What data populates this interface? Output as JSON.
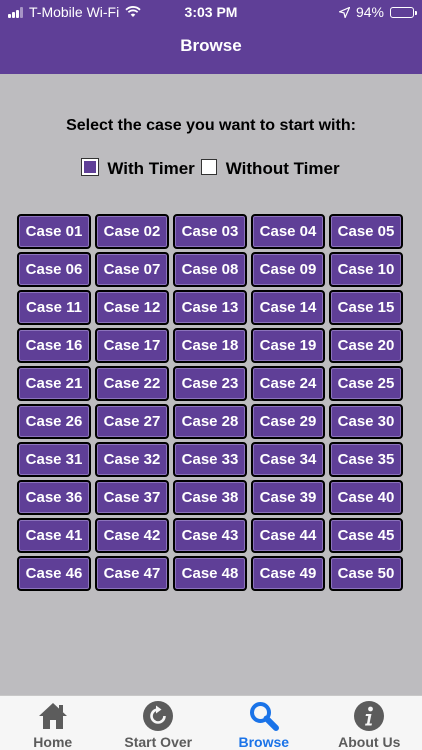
{
  "status_bar": {
    "carrier": "T-Mobile Wi-Fi",
    "time": "3:03 PM",
    "battery": "94%",
    "battery_level": 0.94
  },
  "nav": {
    "title": "Browse"
  },
  "prompt": "Select the case you want to start with:",
  "timer_options": [
    {
      "label": "With Timer",
      "checked": true
    },
    {
      "label": "Without Timer",
      "checked": false
    }
  ],
  "cases": [
    "Case 01",
    "Case 02",
    "Case 03",
    "Case 04",
    "Case 05",
    "Case 06",
    "Case 07",
    "Case 08",
    "Case 09",
    "Case 10",
    "Case 11",
    "Case 12",
    "Case 13",
    "Case 14",
    "Case 15",
    "Case 16",
    "Case 17",
    "Case 18",
    "Case 19",
    "Case 20",
    "Case 21",
    "Case 22",
    "Case 23",
    "Case 24",
    "Case 25",
    "Case 26",
    "Case 27",
    "Case 28",
    "Case 29",
    "Case 30",
    "Case 31",
    "Case 32",
    "Case 33",
    "Case 34",
    "Case 35",
    "Case 36",
    "Case 37",
    "Case 38",
    "Case 39",
    "Case 40",
    "Case 41",
    "Case 42",
    "Case 43",
    "Case 44",
    "Case 45",
    "Case 46",
    "Case 47",
    "Case 48",
    "Case 49",
    "Case 50"
  ],
  "tabs": [
    {
      "label": "Home",
      "icon": "home-icon",
      "active": false
    },
    {
      "label": "Start Over",
      "icon": "refresh-icon",
      "active": false
    },
    {
      "label": "Browse",
      "icon": "search-icon",
      "active": true
    },
    {
      "label": "About Us",
      "icon": "info-icon",
      "active": false
    }
  ],
  "colors": {
    "brand": "#5f3f97",
    "background": "#bdbcbf",
    "active_tab": "#1a73e8",
    "inactive_tab": "#5c5c5c"
  }
}
